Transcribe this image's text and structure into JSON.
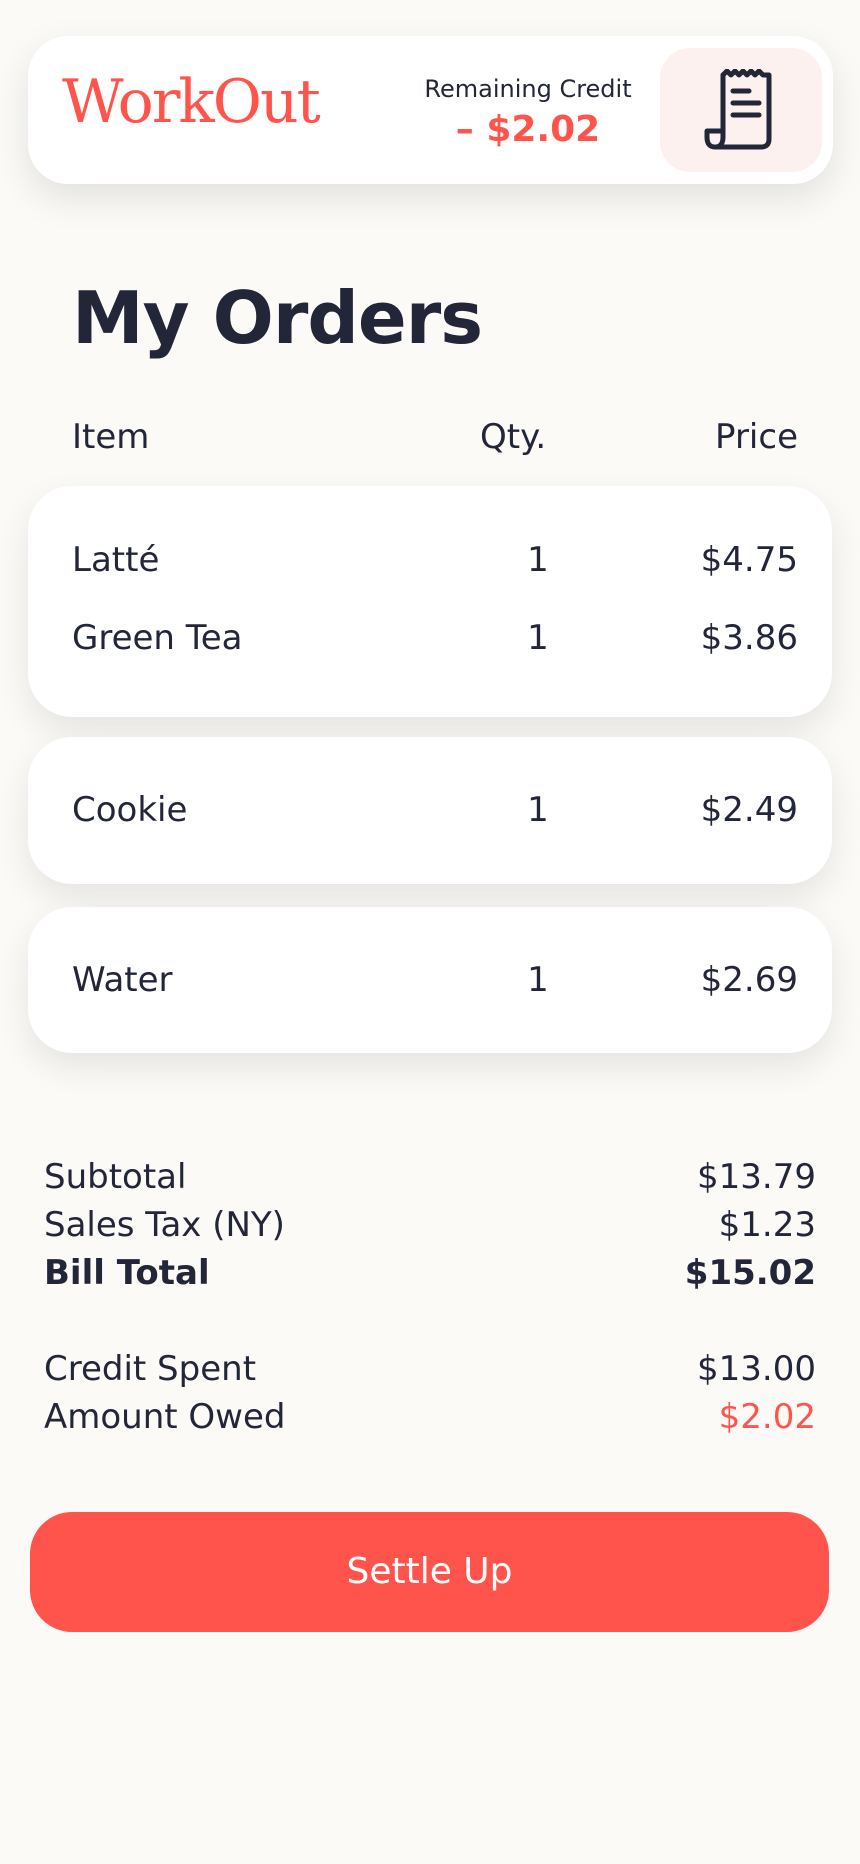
{
  "header": {
    "logo": "WorkOut",
    "credit_label": "Remaining Credit",
    "credit_value": "– $2.02",
    "receipt_icon": "receipt-icon"
  },
  "page": {
    "title": "My Orders"
  },
  "columns": {
    "item": "Item",
    "qty": "Qty.",
    "price": "Price"
  },
  "orders": [
    {
      "items": [
        {
          "name": "Latté",
          "qty": "1",
          "price": "$4.75"
        },
        {
          "name": "Green Tea",
          "qty": "1",
          "price": "$3.86"
        }
      ]
    },
    {
      "items": [
        {
          "name": "Cookie",
          "qty": "1",
          "price": "$2.49"
        }
      ]
    },
    {
      "items": [
        {
          "name": "Water",
          "qty": "1",
          "price": "$2.69"
        }
      ]
    }
  ],
  "summary": {
    "subtotal_label": "Subtotal",
    "subtotal_value": "$13.79",
    "tax_label": "Sales Tax (NY)",
    "tax_value": "$1.23",
    "total_label": "Bill Total",
    "total_value": "$15.02",
    "credit_label": "Credit Spent",
    "credit_value": "$13.00",
    "owed_label": "Amount Owed",
    "owed_value": "$2.02"
  },
  "actions": {
    "settle_label": "Settle Up"
  },
  "colors": {
    "accent": "#ff544b",
    "text": "#222638",
    "background": "#fbfaf7",
    "card": "#ffffff",
    "icon_bg": "#fcf1ee"
  }
}
